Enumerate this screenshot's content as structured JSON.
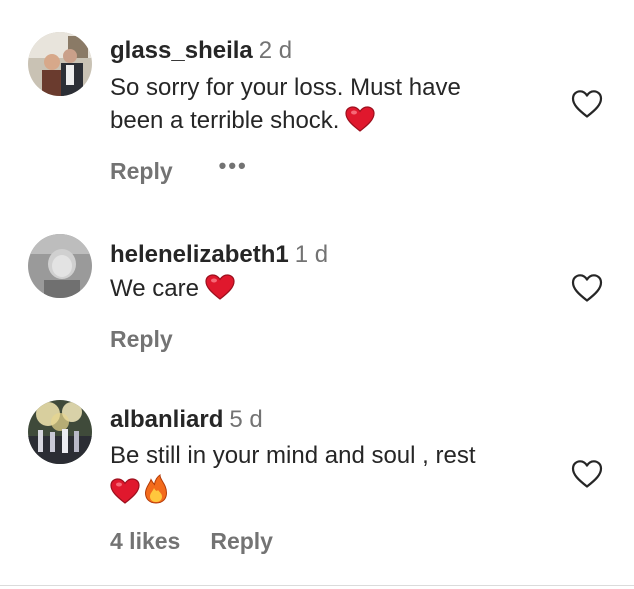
{
  "comments": [
    {
      "username": "glass_sheila",
      "time": "2 d",
      "text_lines": [
        "So sorry for your loss. Must have",
        "been a terrible shock."
      ],
      "emojis": [
        "heart"
      ],
      "reply_label": "Reply",
      "more_label": "•••"
    },
    {
      "username": "helenelizabeth1",
      "time": "1 d",
      "text_lines": [
        "We care"
      ],
      "emojis": [
        "heart"
      ],
      "reply_label": "Reply"
    },
    {
      "username": "albanliard",
      "time": "5 d",
      "text_lines": [
        "Be still in your mind and soul , rest"
      ],
      "emojis": [
        "heart",
        "fire"
      ],
      "likes_label": "4 likes",
      "reply_label": "Reply"
    }
  ],
  "colors": {
    "text": "#262626",
    "muted": "#737373",
    "heart_red": "#e0182d",
    "divider": "#dbdbdb"
  },
  "icons": [
    "heart-outline-icon",
    "red-heart-emoji",
    "fire-emoji",
    "more-dots-icon"
  ]
}
